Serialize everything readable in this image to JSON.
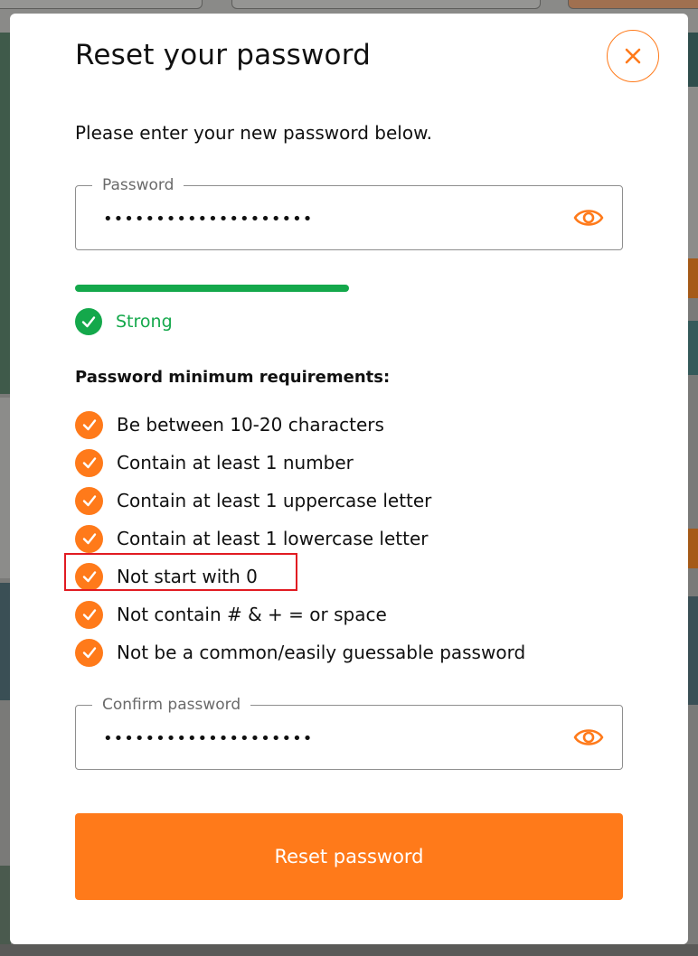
{
  "modal": {
    "title": "Reset your password",
    "subtitle": "Please enter your new password below.",
    "close_icon": "close-icon"
  },
  "password_field": {
    "label": "Password",
    "value": "••••••••••••••••••••",
    "eye_icon": "eye-icon"
  },
  "strength": {
    "label": "Strong",
    "level": 0.5,
    "color": "#14a84b",
    "icon": "check-circle-icon"
  },
  "requirements": {
    "title": "Password minimum requirements:",
    "items": [
      "Be between 10-20 characters",
      "Contain at least 1 number",
      "Contain at least 1 uppercase letter",
      "Contain at least 1 lowercase letter",
      "Not start with 0",
      "Not contain # & + = or space",
      "Not be a common/easily guessable password"
    ],
    "highlighted_item": "Not start with 0"
  },
  "confirm_field": {
    "label": "Confirm password",
    "value": "••••••••••••••••••••",
    "eye_icon": "eye-icon"
  },
  "submit": {
    "label": "Reset password"
  },
  "colors": {
    "accent": "#ff7a1a",
    "success": "#14a84b",
    "highlight": "#e11b22"
  }
}
